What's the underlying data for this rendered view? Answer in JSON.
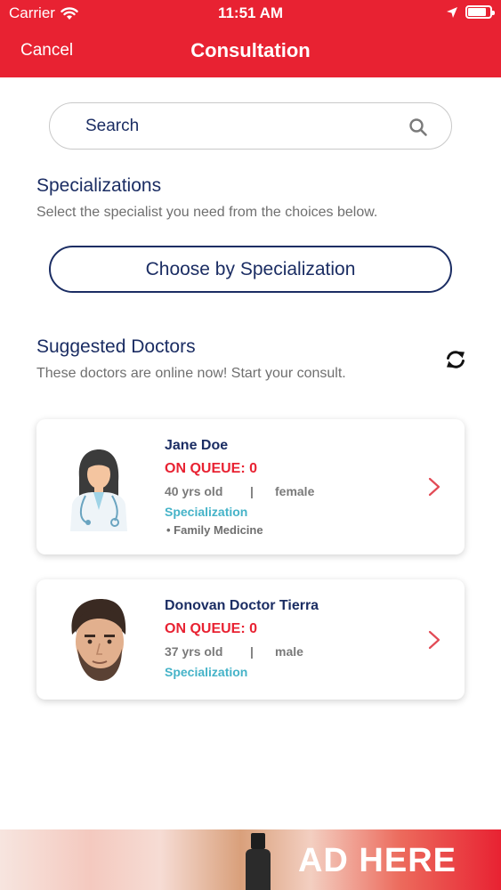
{
  "status_bar": {
    "carrier": "Carrier",
    "time": "11:51 AM"
  },
  "nav": {
    "cancel_label": "Cancel",
    "title": "Consultation"
  },
  "search": {
    "placeholder": "Search"
  },
  "specializations": {
    "title": "Specializations",
    "subtitle": "Select the specialist you need from the choices below.",
    "button_label": "Choose by Specialization"
  },
  "suggested": {
    "title": "Suggested Doctors",
    "subtitle": "These doctors are online now! Start your consult."
  },
  "doctors": [
    {
      "name": "Jane Doe",
      "queue": "ON QUEUE: 0",
      "age": "40 yrs old",
      "separator": "|",
      "gender": "female",
      "spec_label": "Specialization",
      "specializations": [
        "• Family Medicine"
      ]
    },
    {
      "name": "Donovan Doctor Tierra",
      "queue": "ON QUEUE: 0",
      "age": "37 yrs old",
      "separator": "|",
      "gender": "male",
      "spec_label": "Specialization",
      "specializations": []
    }
  ],
  "ad": {
    "text": "AD HERE"
  },
  "colors": {
    "brand_red": "#e82232",
    "navy": "#1b2d63",
    "teal": "#45b3c8"
  }
}
